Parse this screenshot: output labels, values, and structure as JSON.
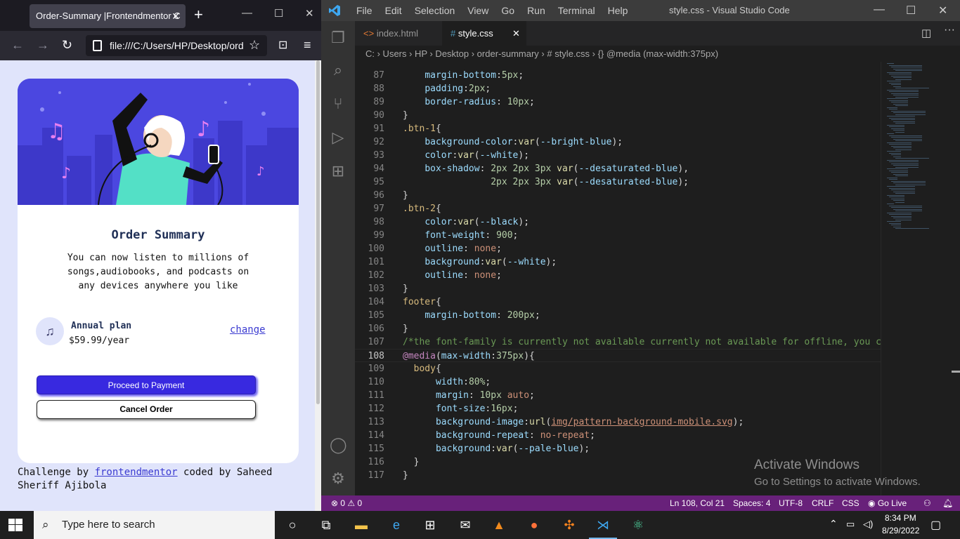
{
  "firefox": {
    "tab_title": "Order-Summary |Frontendmentor C",
    "tab_close": "✕",
    "new_tab": "+",
    "url": "file:///C:/Users/HP/Desktop/ord",
    "page": {
      "title": "Order Summary",
      "text": "You can now listen to millions of songs,audiobooks, and podcasts on any devices anywhere you like",
      "plan_name": "Annual plan",
      "plan_price": "$59.99/year",
      "change_link": "change",
      "proceed_button": "Proceed to Payment",
      "cancel_button": "Cancel Order",
      "footer_prefix": "Challenge by ",
      "footer_link": "frontendmentor",
      "footer_suffix": " coded by Saheed Sheriff Ajibola"
    }
  },
  "vscode": {
    "menu": [
      "File",
      "Edit",
      "Selection",
      "View",
      "Go",
      "Run",
      "Terminal",
      "Help"
    ],
    "window_title": "style.css - Visual Studio Code",
    "tabs": [
      {
        "label": "index.html",
        "icon": "<>"
      },
      {
        "label": "style.css",
        "icon": "#",
        "close": "✕"
      }
    ],
    "breadcrumb": "C: › Users › HP › Desktop › order-summary › # style.css › {} @media (max-width:375px)",
    "code_lines": [
      {
        "n": "87",
        "html": "    <span class='c-prop'>margin-bottom</span>:<span class='c-num'>5px</span>;"
      },
      {
        "n": "88",
        "html": "    <span class='c-prop'>padding</span>:<span class='c-num'>2px</span>;"
      },
      {
        "n": "89",
        "html": "    <span class='c-prop'>border-radius</span>: <span class='c-num'>10px</span>;"
      },
      {
        "n": "90",
        "html": "}"
      },
      {
        "n": "91",
        "html": "<span class='c-sel'>.btn-1</span>{"
      },
      {
        "n": "92",
        "html": "    <span class='c-prop'>background-color</span>:<span class='c-fn'>var</span>(<span class='c-prop'>--bright-blue</span>);"
      },
      {
        "n": "93",
        "html": "    <span class='c-prop'>color</span>:<span class='c-fn'>var</span>(<span class='c-prop'>--white</span>);"
      },
      {
        "n": "94",
        "html": "    <span class='c-prop'>box-shadow</span>: <span class='c-num'>2px 2px 3px</span> <span class='c-fn'>var</span>(<span class='c-prop'>--desaturated-blue</span>),"
      },
      {
        "n": "95",
        "html": "                <span class='c-num'>2px 2px 3px</span> <span class='c-fn'>var</span>(<span class='c-prop'>--desaturated-blue</span>);"
      },
      {
        "n": "96",
        "html": "}"
      },
      {
        "n": "97",
        "html": "<span class='c-sel'>.btn-2</span>{"
      },
      {
        "n": "98",
        "html": "    <span class='c-prop'>color</span>:<span class='c-fn'>var</span>(<span class='c-prop'>--black</span>);"
      },
      {
        "n": "99",
        "html": "    <span class='c-prop'>font-weight</span>: <span class='c-num'>900</span>;"
      },
      {
        "n": "100",
        "html": "    <span class='c-prop'>outline</span>: <span class='c-val'>none</span>;"
      },
      {
        "n": "101",
        "html": "    <span class='c-prop'>background</span>:<span class='c-fn'>var</span>(<span class='c-prop'>--white</span>);"
      },
      {
        "n": "102",
        "html": "    <span class='c-prop'>outline</span>: <span class='c-val'>none</span>;"
      },
      {
        "n": "103",
        "html": "}"
      },
      {
        "n": "104",
        "html": "<span class='c-sel'>footer</span>{"
      },
      {
        "n": "105",
        "html": "    <span class='c-prop'>margin-bottom</span>: <span class='c-num'>200px</span>;"
      },
      {
        "n": "106",
        "html": "}"
      },
      {
        "n": "107",
        "html": "<span class='c-cmt'>/*the font-family is currently not available currently not available for offline, you car</span>"
      },
      {
        "n": "108",
        "html": "<span class='c-at'>@media</span>(<span class='c-prop'>max-width</span>:<span class='c-num'>375px</span>){"
      },
      {
        "n": "109",
        "html": "  <span class='c-sel'>body</span>{"
      },
      {
        "n": "110",
        "html": "      <span class='c-prop'>width</span>:<span class='c-num'>80%</span>;"
      },
      {
        "n": "111",
        "html": "      <span class='c-prop'>margin</span>: <span class='c-num'>10px</span> <span class='c-val'>auto</span>;"
      },
      {
        "n": "112",
        "html": "      <span class='c-prop'>font-size</span>:<span class='c-num'>16px</span>;"
      },
      {
        "n": "113",
        "html": "      <span class='c-prop'>background-image</span>:<span class='c-fn'>url</span>(<span class='c-url'>img/pattern-background-mobile.svg</span>);"
      },
      {
        "n": "114",
        "html": "      <span class='c-prop'>background-repeat</span>: <span class='c-val'>no-repeat</span>;"
      },
      {
        "n": "115",
        "html": "      <span class='c-prop'>background</span>:<span class='c-fn'>var</span>(<span class='c-prop'>--pale-blue</span>);"
      },
      {
        "n": "116",
        "html": "  }"
      },
      {
        "n": "117",
        "html": "}"
      }
    ],
    "watermark_title": "Activate Windows",
    "watermark_sub": "Go to Settings to activate Windows.",
    "status": {
      "errors": "⊗ 0 ⚠ 0",
      "position": "Ln 108, Col 21",
      "spaces": "Spaces: 4",
      "encoding": "UTF-8",
      "eol": "CRLF",
      "language": "CSS",
      "golive": "Go Live"
    }
  },
  "taskbar": {
    "search_placeholder": "Type here to search",
    "time": "8:34 PM",
    "date": "8/29/2022"
  },
  "colors": {
    "vscode_status": "#68217a",
    "card_hero": "#4b47e0",
    "proceed_button": "#3829e0"
  }
}
